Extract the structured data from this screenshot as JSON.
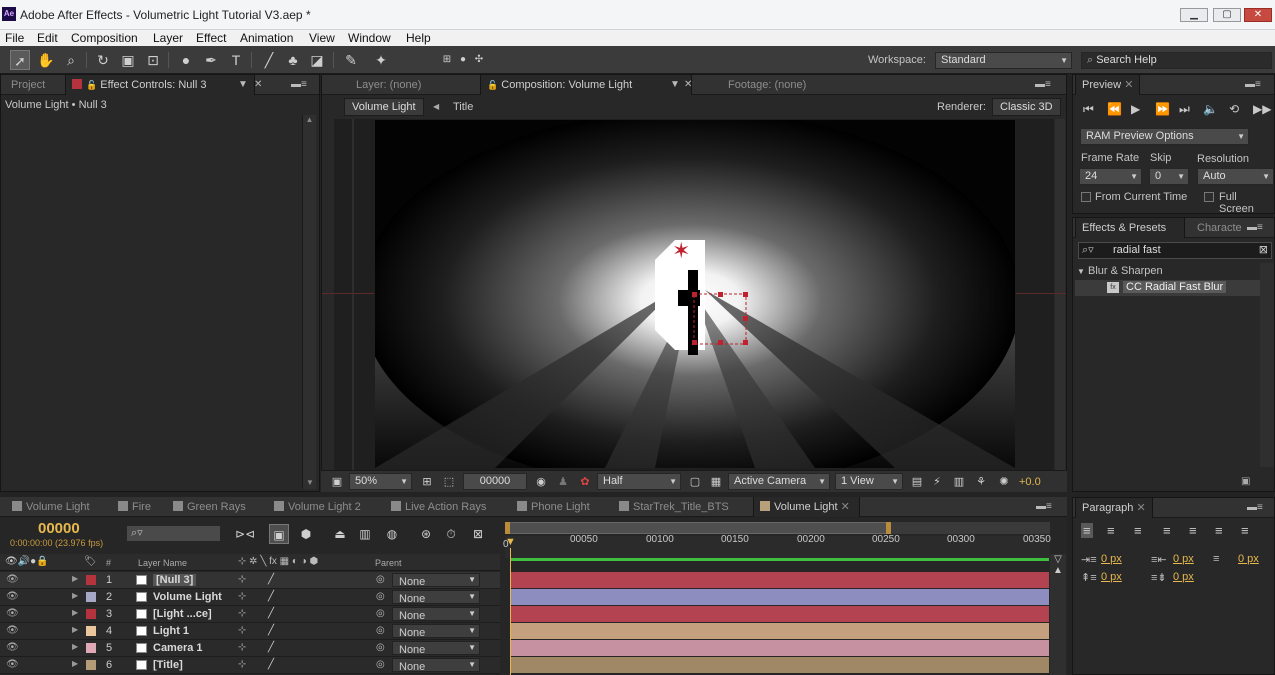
{
  "window": {
    "title": "Adobe After Effects - Volumetric Light Tutorial V3.aep *",
    "app_badge": "Ae"
  },
  "menu": [
    "File",
    "Edit",
    "Composition",
    "Layer",
    "Effect",
    "Animation",
    "View",
    "Window",
    "Help"
  ],
  "toolbar": {
    "workspace_label": "Workspace:",
    "workspace_value": "Standard",
    "search_placeholder": "Search Help"
  },
  "left_panel": {
    "tabs": [
      "Project",
      "Effect Controls: Null 3"
    ],
    "breadcrumb": "Volume Light • Null 3"
  },
  "center_panel": {
    "tabs": [
      "Layer: (none)",
      "Composition: Volume Light",
      "Footage: (none)"
    ],
    "crumbs": [
      "Volume Light",
      "Title"
    ],
    "renderer_label": "Renderer:",
    "renderer_value": "Classic 3D",
    "footer": {
      "zoom": "50%",
      "timecode": "00000",
      "resolution": "Half",
      "camera": "Active Camera",
      "views": "1 View",
      "exposure": "+0.0"
    }
  },
  "preview_panel": {
    "tab": "Preview",
    "ram_options": "RAM Preview Options",
    "frame_rate_label": "Frame Rate",
    "skip_label": "Skip",
    "resolution_label": "Resolution",
    "frame_rate": "24",
    "skip": "0",
    "resolution": "Auto",
    "from_current_time": "From Current Time",
    "full_screen": "Full Screen"
  },
  "effects_panel": {
    "tabs": [
      "Effects & Presets",
      "Characte"
    ],
    "search_value": "radial fast",
    "category": "Blur & Sharpen",
    "item": "CC Radial Fast Blur"
  },
  "timeline": {
    "tabs": [
      "Volume Light",
      "Fire",
      "Green Rays",
      "Volume Light 2",
      "Live Action Rays",
      "Phone Light",
      "StarTrek_Title_BTS",
      "Volume Light"
    ],
    "tab_colors": [
      "#9a9a9a",
      "#9a9a9a",
      "#9a9a9a",
      "#9a9a9a",
      "#9a9a9a",
      "#9a9a9a",
      "#9a9a9a",
      "#c9c9c9"
    ],
    "timecode": "00000",
    "fps": "0:00:00:00 (23.976 fps)",
    "col_number": "#",
    "col_layer_name": "Layer Name",
    "col_parent": "Parent",
    "ruler": [
      "00050",
      "00100",
      "00150",
      "00200",
      "00250",
      "00300",
      "00350"
    ],
    "ruler_start": "0",
    "layers": [
      {
        "num": "1",
        "name": "[Null 3]",
        "label_color": "#b4333d",
        "bar_color": "#b34350",
        "parent": "None"
      },
      {
        "num": "2",
        "name": "Volume Light",
        "label_color": "#a7a7c6",
        "bar_color": "#8d8ebf",
        "parent": "None"
      },
      {
        "num": "3",
        "name": "[Light ...ce]",
        "label_color": "#b4333d",
        "bar_color": "#b34350",
        "parent": "None"
      },
      {
        "num": "4",
        "name": "Light 1",
        "label_color": "#e9c69b",
        "bar_color": "#c4a07f",
        "parent": "None"
      },
      {
        "num": "5",
        "name": "Camera 1",
        "label_color": "#e1a9b7",
        "bar_color": "#c691a0",
        "parent": "None"
      },
      {
        "num": "6",
        "name": "[Title]",
        "label_color": "#b59a78",
        "bar_color": "#a08867",
        "parent": "None"
      }
    ]
  },
  "paragraph_panel": {
    "tab": "Paragraph",
    "indent_values": [
      "0 px",
      "0 px",
      "0 px",
      "0 px",
      "0 px"
    ]
  }
}
